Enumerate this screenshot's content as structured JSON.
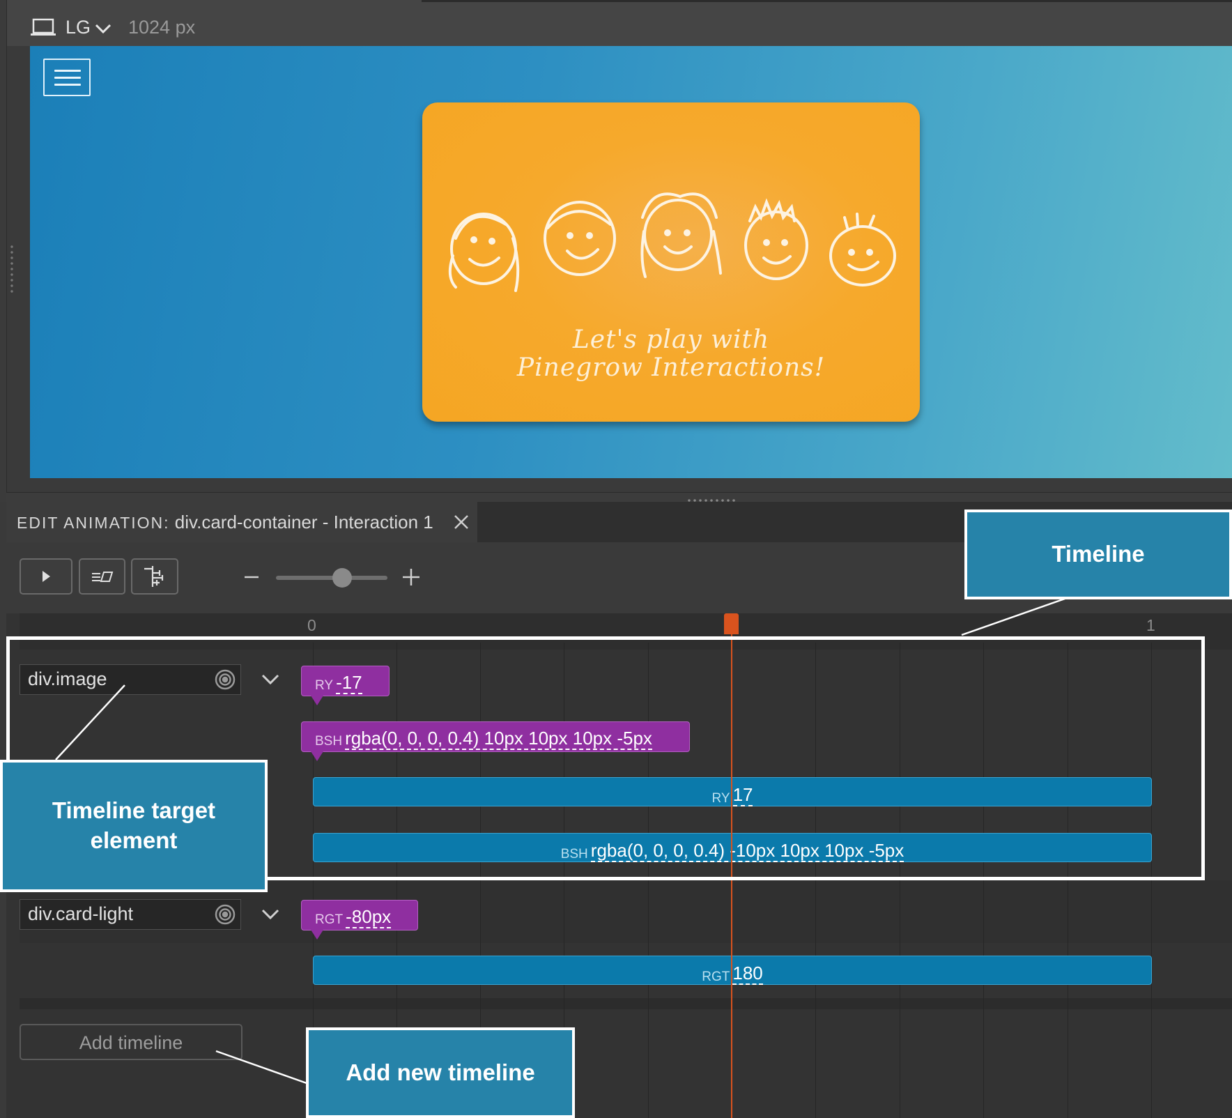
{
  "device_bar": {
    "device": "LG",
    "width": "1024 px"
  },
  "card": {
    "line1": "Let's play with",
    "line2": "Pinegrow Interactions!"
  },
  "panel": {
    "title_prefix": "EDIT ANIMATION:",
    "title": "div.card-container - Interaction 1"
  },
  "ruler": {
    "start": "0",
    "end": "1"
  },
  "timelines": [
    {
      "target": "div.image",
      "keyframes": [
        {
          "prop": "RY",
          "value": "-17"
        },
        {
          "prop": "BSH",
          "value": "rgba(0, 0, 0, 0.4) 10px 10px 10px -5px"
        }
      ],
      "tweens": [
        {
          "prop": "RY",
          "value": "17"
        },
        {
          "prop": "BSH",
          "value": "rgba(0, 0, 0, 0.4) -10px 10px 10px -5px"
        }
      ]
    },
    {
      "target": "div.card-light",
      "keyframes": [
        {
          "prop": "RGT",
          "value": "-80px"
        }
      ],
      "tweens": [
        {
          "prop": "RGT",
          "value": "180"
        }
      ]
    }
  ],
  "add_timeline_label": "Add timeline",
  "callouts": {
    "timeline": "Timeline",
    "target_line1": "Timeline target",
    "target_line2": "element",
    "add_new": "Add new timeline"
  },
  "colors": {
    "keyframe": "#8f2fa0",
    "tween": "#0b7aab",
    "playhead": "#d9531e",
    "callout": "#2683a9",
    "card": "#f6a92c"
  },
  "zoom_level": 0.6,
  "playhead_position": 0.5
}
